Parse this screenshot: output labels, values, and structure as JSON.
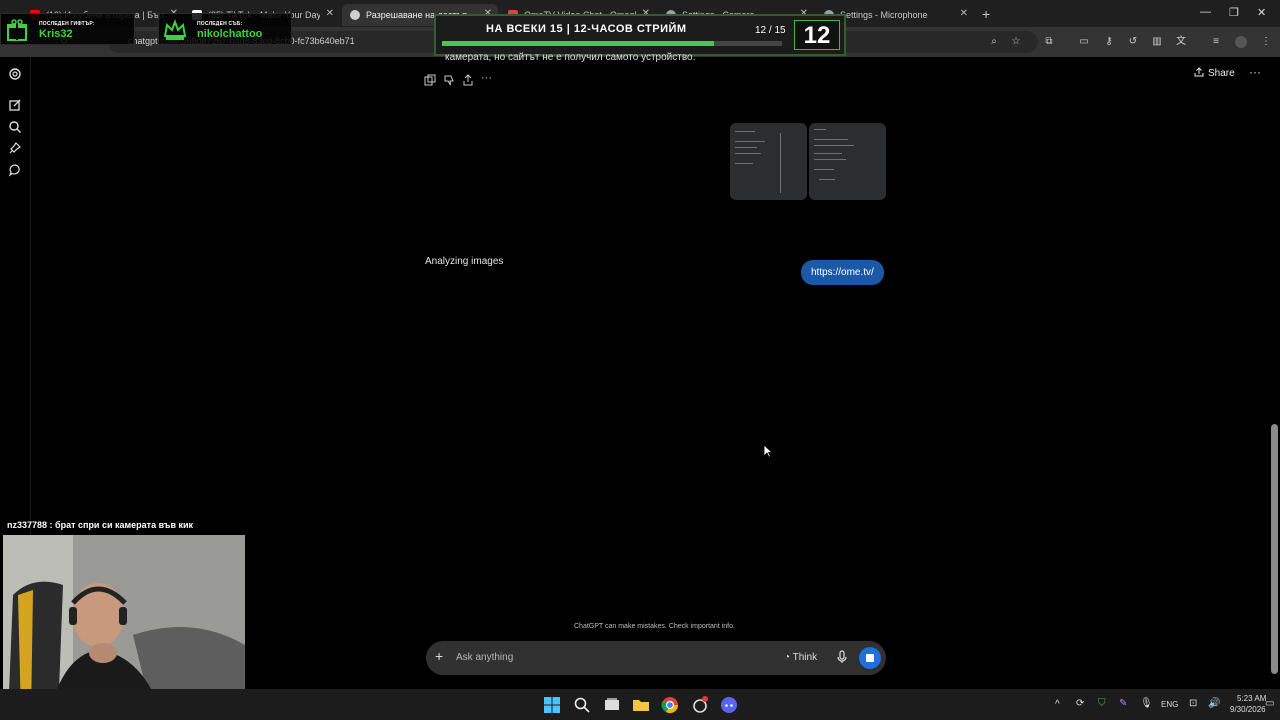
{
  "browser": {
    "tabs": [
      {
        "title": "(19) Изгубени в гората | Бърло",
        "favicon_color": "#ff0000",
        "active": false
      },
      {
        "title": "(85) TikTok - Make Your Day",
        "favicon_color": "#ffffff",
        "active": false
      },
      {
        "title": "Разрешаване на достъп",
        "favicon_color": "#cfcfcf",
        "active": true
      },
      {
        "title": "OmeTV Video Chat - Omegle",
        "favicon_color": "#e04040",
        "active": false
      },
      {
        "title": "Settings - Camera",
        "favicon_color": "#9aa0a6",
        "active": false
      },
      {
        "title": "Settings - Microphone",
        "favicon_color": "#9aa0a6",
        "active": false
      }
    ],
    "url": "chatgpt.com/c/68de7267-b4d8-83cd-8cb0-fc73b640eb71",
    "new_tab_symbol": "+"
  },
  "overlays": {
    "last_gift": {
      "label": "ПОСЛЕДЕН ГИФТЪР:",
      "name": "Kris32"
    },
    "last_sub": {
      "label": "ПОСЛЕДЕН СЪБ:",
      "name": "nikolchattoo"
    },
    "goal": {
      "title": "НА ВСЕКИ 15 | 12-ЧАСОВ СТРИЙМ",
      "count": "12 / 15",
      "big_number": "12",
      "progress": 0.8
    },
    "cam_caption": "nz337788 : брат спри си камерата във кик"
  },
  "chat": {
    "previous_text_fragment": "камерата, но сайтът не е получил самото устройство.",
    "share_label": "Share",
    "user_link": "https://ome.tv/",
    "status": "Analyzing images",
    "composer_placeholder": "Ask anything",
    "think_label": "Think",
    "disclaimer": "ChatGPT can make mistakes. Check important info."
  },
  "taskbar": {
    "language": "ENG",
    "time": "5:23 AM",
    "date": "9/30/2026"
  },
  "colors": {
    "accent_green": "#42c94f",
    "user_bubble": "#1b58a8",
    "stop_button": "#1f6fdd"
  }
}
